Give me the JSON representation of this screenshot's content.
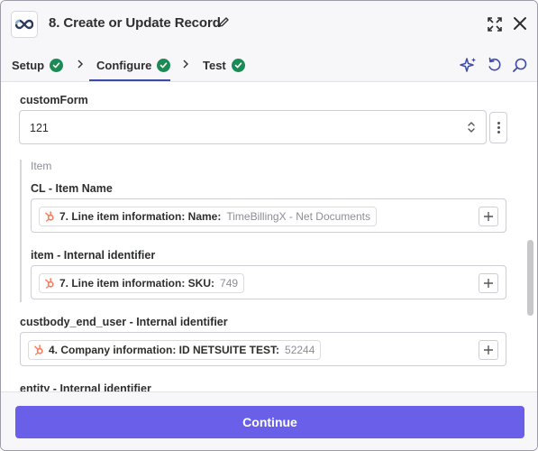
{
  "header": {
    "title": "8. Create or Update Record",
    "app_icon": "infinity-logo-icon",
    "edit_icon": "pencil-icon",
    "expand_icon": "expand-icon",
    "close_icon": "close-icon"
  },
  "tabs": [
    {
      "label": "Setup",
      "status": "complete"
    },
    {
      "label": "Configure",
      "status": "complete",
      "active": true
    },
    {
      "label": "Test",
      "status": "complete"
    }
  ],
  "toolbar_icons": [
    "ai-sparkle-icon",
    "refresh-icon",
    "search-icon"
  ],
  "form": {
    "custom_form": {
      "label": "customForm",
      "value": "121"
    },
    "item_group": {
      "label": "Item",
      "fields": [
        {
          "label": "CL - Item Name",
          "pill_label": "7. Line item information: Name:",
          "pill_value": "TimeBillingX - Net Documents"
        },
        {
          "label": "item - Internal identifier",
          "pill_label": "7. Line item information: SKU:",
          "pill_value": "749"
        }
      ]
    },
    "end_user": {
      "label": "custbody_end_user - Internal identifier",
      "pill_label": "4. Company information: ID NETSUITE TEST:",
      "pill_value": "52244"
    },
    "entity": {
      "label": "entity - Internal identifier"
    }
  },
  "footer": {
    "continue_label": "Continue"
  },
  "colors": {
    "accent": "#6a5fe8",
    "success": "#1c8a54",
    "hubspot": "#ff7a59"
  }
}
